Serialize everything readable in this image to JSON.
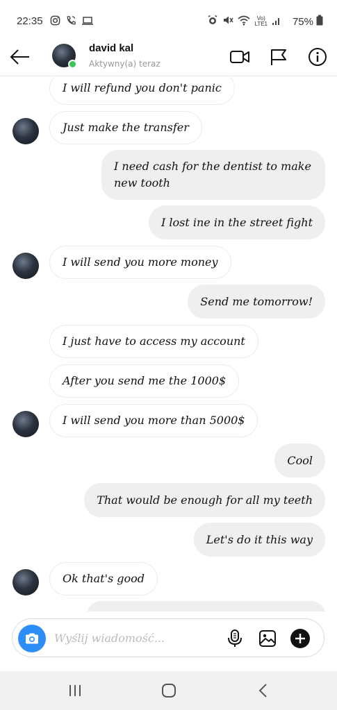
{
  "status_bar": {
    "time": "22:35",
    "battery": "75%",
    "network_top": "Vo)",
    "network_bottom": "LTE1",
    "icons_left": [
      "instagram-icon",
      "phone-wifi-icon",
      "laptop-icon"
    ],
    "icons_right": [
      "alarm-icon",
      "mute-icon",
      "wifi-icon",
      "signal-icon",
      "battery-icon"
    ]
  },
  "header": {
    "name": "david kal",
    "status": "Aktywny(a) teraz",
    "online_color": "#3ec55a"
  },
  "messages": [
    {
      "from": "them",
      "text": "I will refund you don't panic",
      "avatar": false
    },
    {
      "from": "them",
      "text": "Just make the transfer",
      "avatar": true
    },
    {
      "from": "me",
      "text": "I need cash for the dentist to make new tooth"
    },
    {
      "from": "me",
      "text": "I lost ine in the street fight"
    },
    {
      "from": "them",
      "text": "I will send you more money",
      "avatar": true
    },
    {
      "from": "me",
      "text": "Send me tomorrow!"
    },
    {
      "from": "them",
      "text": "I just have to access my account",
      "avatar": false
    },
    {
      "from": "them",
      "text": "After you send me the 1000$",
      "avatar": false
    },
    {
      "from": "them",
      "text": "I will send you more than 5000$",
      "avatar": true
    },
    {
      "from": "me",
      "text": "Cool"
    },
    {
      "from": "me",
      "text": "That would be enough for all my teeth"
    },
    {
      "from": "me",
      "text": "Let's do it this way"
    },
    {
      "from": "them",
      "text": "Ok that's good",
      "avatar": true
    }
  ],
  "composer": {
    "placeholder": "Wyślij wiadomość...",
    "value": ""
  },
  "colors": {
    "accent": "#2d8ef7",
    "outgoing_bubble": "#efefef",
    "incoming_border": "#ececec"
  }
}
